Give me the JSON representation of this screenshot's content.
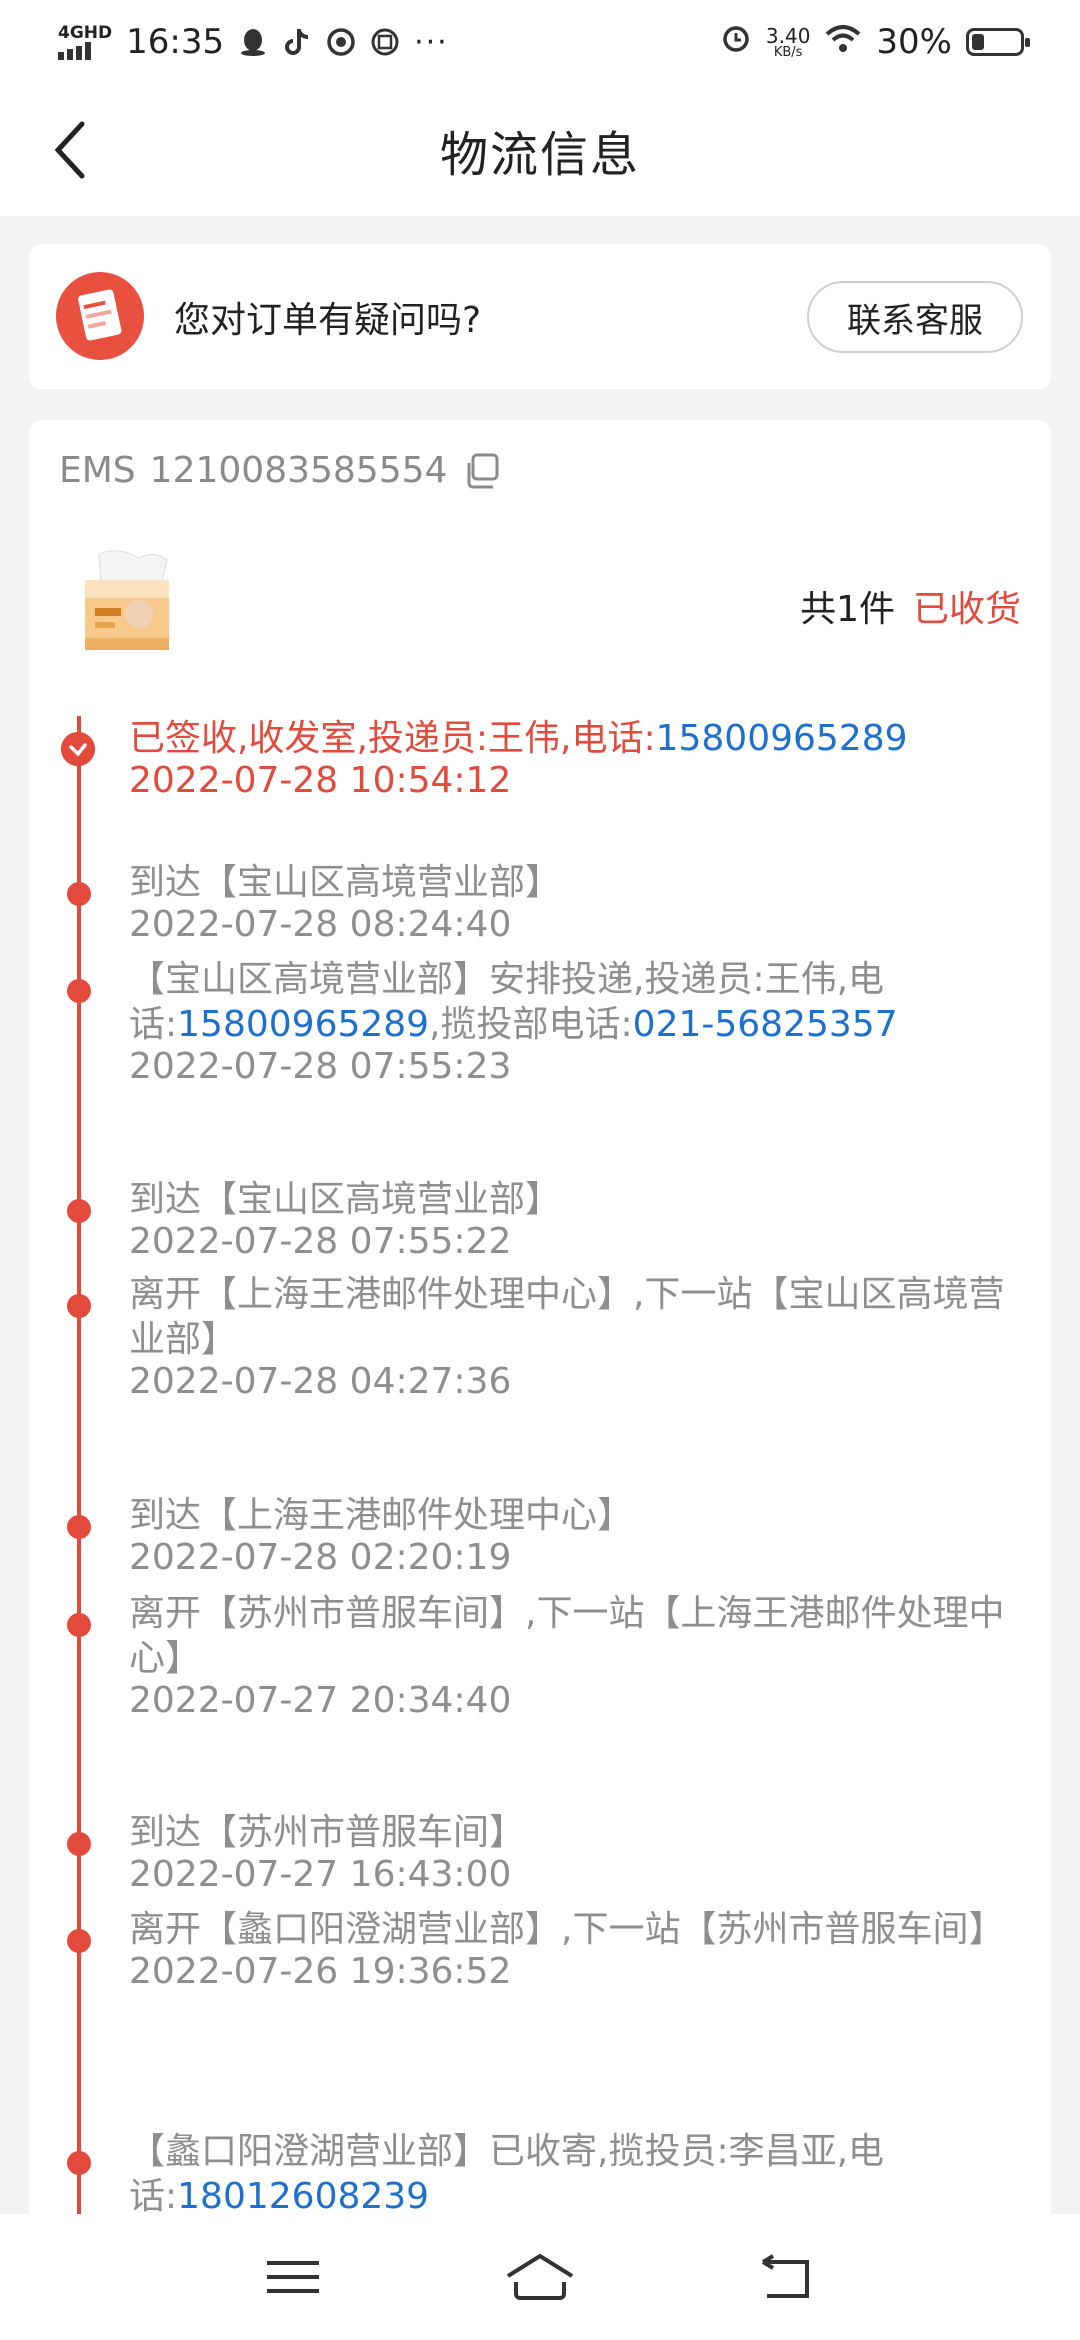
{
  "status_bar": {
    "network": "4GHD",
    "time": "16:35",
    "speed_value": "3.40",
    "speed_unit": "KB/s",
    "battery": "30%"
  },
  "header": {
    "title": "物流信息"
  },
  "question_card": {
    "text": "您对订单有疑问吗?",
    "button": "联系客服"
  },
  "shipment": {
    "carrier": "EMS",
    "tracking_number": "1210083585554",
    "count_text": "共1件",
    "status_text": "已收货"
  },
  "timeline": [
    {
      "parts": [
        {
          "text": "已签收,收发室,投递员:王伟,电话:",
          "phone": false
        },
        {
          "text": "15800965289",
          "phone": true
        }
      ],
      "time": "2022-07-28 10:54:12",
      "active": true
    },
    {
      "parts": [
        {
          "text": "到达【宝山区高境营业部】",
          "phone": false
        }
      ],
      "time": "2022-07-28 08:24:40"
    },
    {
      "parts": [
        {
          "text": "【宝山区高境营业部】安排投递,投递员:王伟,电话:",
          "phone": false
        },
        {
          "text": "15800965289",
          "phone": true
        },
        {
          "text": ",揽投部电话:",
          "phone": false
        },
        {
          "text": "021-56825357",
          "phone": true
        }
      ],
      "time": "2022-07-28 07:55:23"
    },
    {
      "parts": [
        {
          "text": "到达【宝山区高境营业部】",
          "phone": false
        }
      ],
      "time": "2022-07-28 07:55:22"
    },
    {
      "parts": [
        {
          "text": "离开【上海王港邮件处理中心】,下一站【宝山区高境营业部】",
          "phone": false
        }
      ],
      "time": "2022-07-28 04:27:36"
    },
    {
      "parts": [
        {
          "text": "到达【上海王港邮件处理中心】",
          "phone": false
        }
      ],
      "time": "2022-07-28 02:20:19"
    },
    {
      "parts": [
        {
          "text": "离开【苏州市普服车间】,下一站【上海王港邮件处理中心】",
          "phone": false
        }
      ],
      "time": "2022-07-27 20:34:40"
    },
    {
      "parts": [
        {
          "text": "到达【苏州市普服车间】",
          "phone": false
        }
      ],
      "time": "2022-07-27 16:43:00"
    },
    {
      "parts": [
        {
          "text": "离开【蠡口阳澄湖营业部】,下一站【苏州市普服车间】",
          "phone": false
        }
      ],
      "time": "2022-07-26 19:36:52"
    },
    {
      "parts": [
        {
          "text": "【蠡口阳澄湖营业部】已收寄,揽投员:李昌亚,电话:",
          "phone": false
        },
        {
          "text": "18012608239",
          "phone": true
        }
      ],
      "time": ""
    }
  ],
  "colors": {
    "accent_red": "#e24a3b",
    "link_blue": "#1d6fd0",
    "muted_text": "#8e8e8e"
  }
}
